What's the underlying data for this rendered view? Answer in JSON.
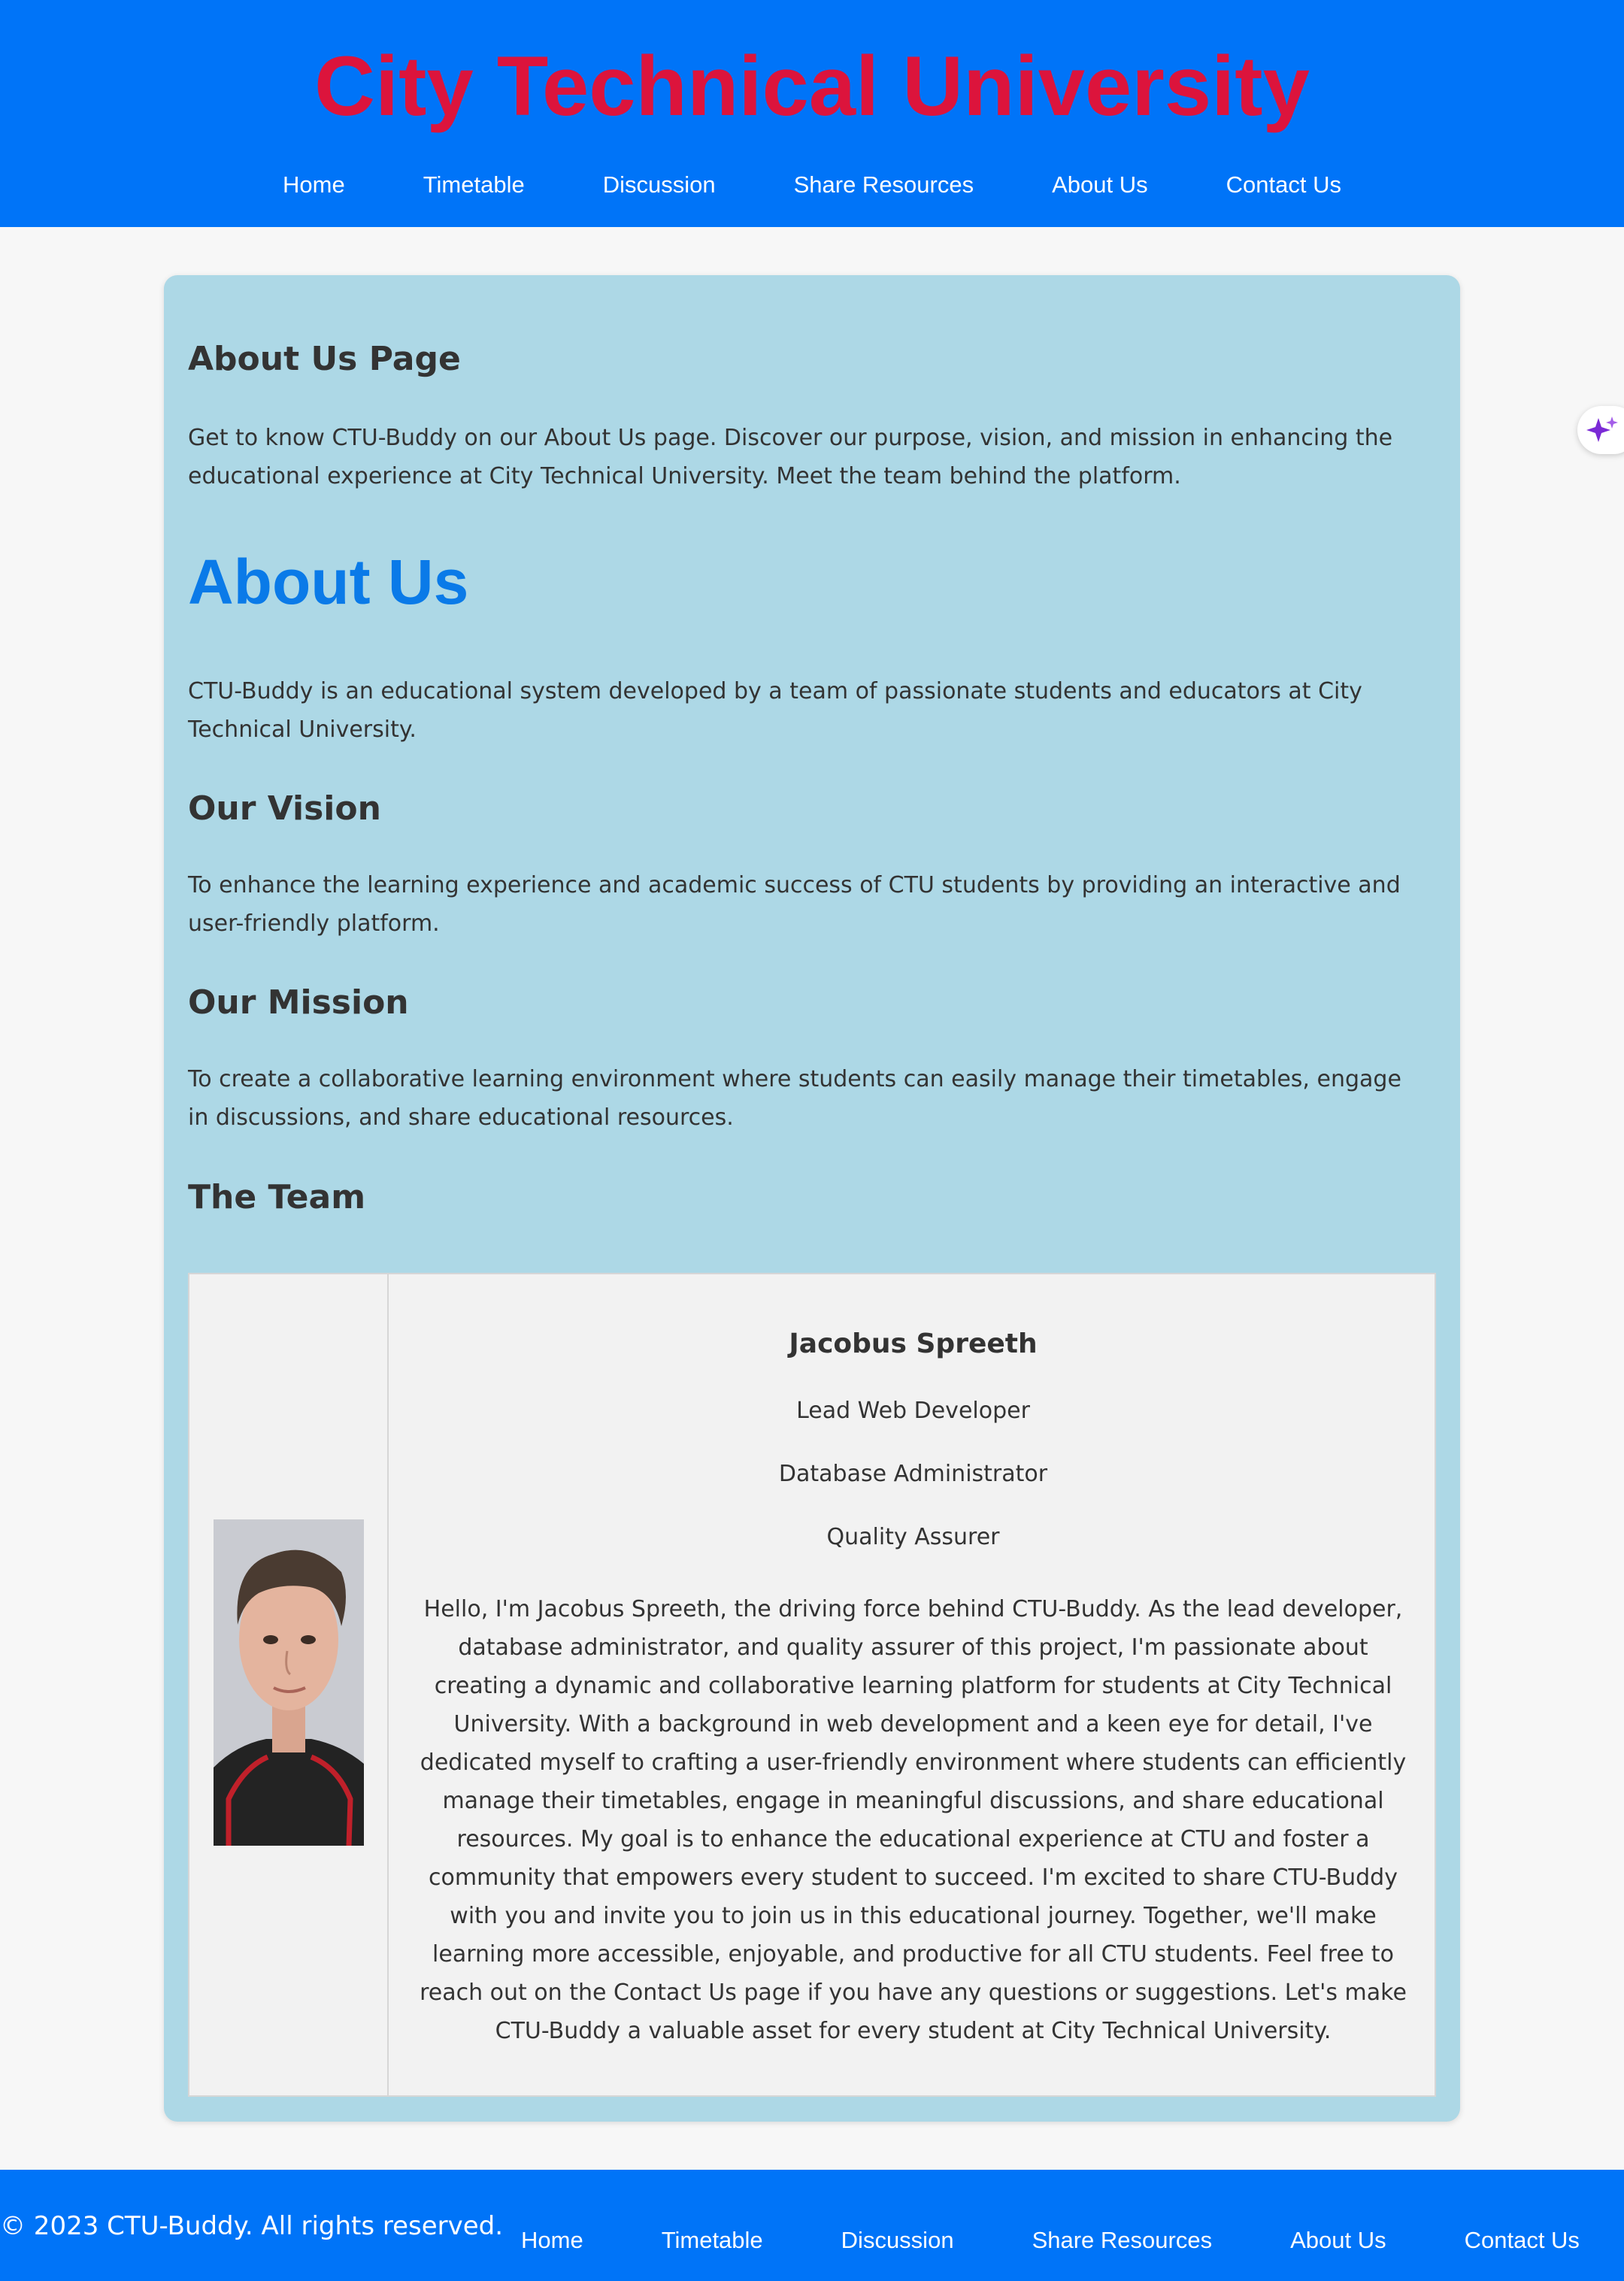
{
  "header": {
    "site_title": "City Technical University",
    "nav": [
      "Home",
      "Timetable",
      "Discussion",
      "Share Resources",
      "About Us",
      "Contact Us"
    ]
  },
  "main": {
    "page_heading": "About Us Page",
    "intro": "Get to know CTU-Buddy on our About Us page. Discover our purpose, vision, and mission in enhancing the educational experience at City Technical University. Meet the team behind the platform.",
    "about_title": "About Us",
    "about_text": "CTU-Buddy is an educational system developed by a team of passionate students and educators at City Technical University.",
    "vision_heading": "Our Vision",
    "vision_text": "To enhance the learning experience and academic success of CTU students by providing an interactive and user-friendly platform.",
    "mission_heading": "Our Mission",
    "mission_text": "To create a collaborative learning environment where students can easily manage their timetables, engage in discussions, and share educational resources.",
    "team_heading": "The Team",
    "team": {
      "name": "Jacobus Spreeth",
      "roles": [
        "Lead Web Developer",
        "Database Administrator",
        "Quality Assurer"
      ],
      "bio": "Hello, I'm Jacobus Spreeth, the driving force behind CTU-Buddy. As the lead developer, database administrator, and quality assurer of this project, I'm passionate about creating a dynamic and collaborative learning platform for students at City Technical University. With a background in web development and a keen eye for detail, I've dedicated myself to crafting a user-friendly environment where students can efficiently manage their timetables, engage in meaningful discussions, and share educational resources. My goal is to enhance the educational experience at CTU and foster a community that empowers every student to succeed. I'm excited to share CTU-Buddy with you and invite you to join us in this educational journey. Together, we'll make learning more accessible, enjoyable, and productive for all CTU students. Feel free to reach out on the Contact Us page if you have any questions or suggestions. Let's make CTU-Buddy a valuable asset for every student at City Technical University."
    }
  },
  "footer": {
    "copyright": "© 2023 CTU-Buddy. All rights reserved.",
    "nav": [
      "Home",
      "Timetable",
      "Discussion",
      "Share Resources",
      "About Us",
      "Contact Us"
    ]
  },
  "colors": {
    "header_bg": "#0074f8",
    "title_red": "#dc143c",
    "card_bg": "#add8e6",
    "about_blue": "#0a7ae8",
    "team_bg": "#f2f2f2"
  },
  "icons": {
    "assistant": "sparkle-icon"
  }
}
